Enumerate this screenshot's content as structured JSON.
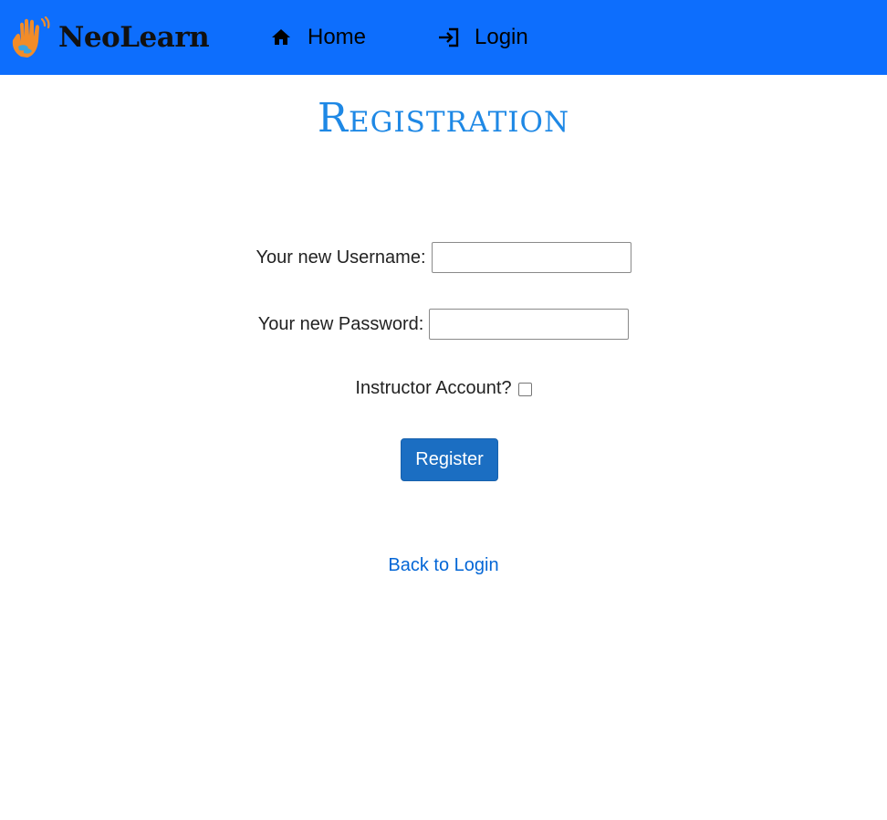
{
  "brand": {
    "name": "NeoLearn",
    "logo_icon": "waving-hand-icon",
    "logo_colors": [
      "#f28c28",
      "#3ba3e0"
    ]
  },
  "nav": {
    "background": "#0d6efd",
    "items": [
      {
        "label": "Home",
        "icon": "home-icon"
      },
      {
        "label": "Login",
        "icon": "login-icon"
      }
    ]
  },
  "page": {
    "title": "Registration",
    "title_color": "#1e88e5"
  },
  "form": {
    "username_label": "Your new Username:",
    "username_value": "",
    "password_label": "Your new Password:",
    "password_value": "",
    "instructor_label": "Instructor Account?",
    "instructor_checked": false,
    "submit_label": "Register",
    "submit_color": "#1b6ec2"
  },
  "footer_link": {
    "label": "Back to Login",
    "color": "#0366d6"
  }
}
